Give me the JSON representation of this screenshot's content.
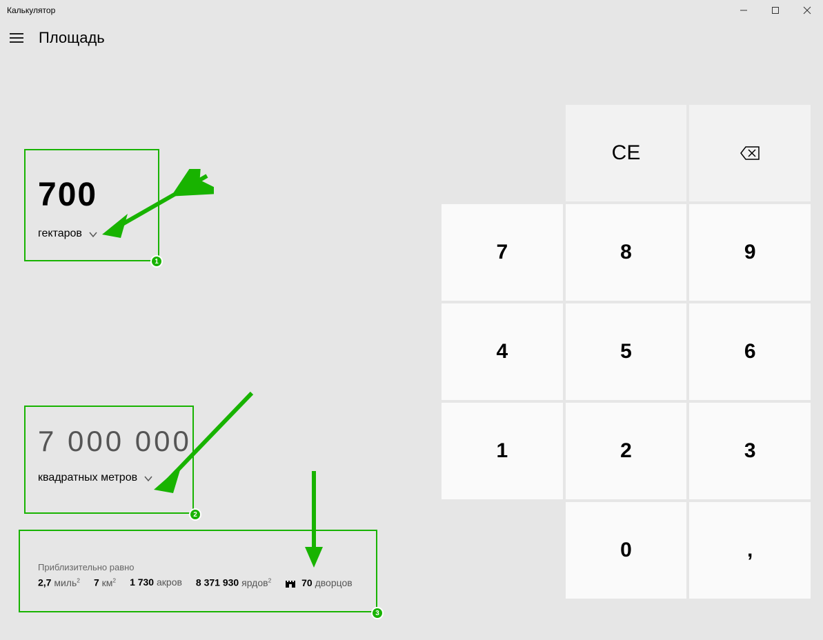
{
  "window": {
    "title": "Калькулятор"
  },
  "header": {
    "mode": "Площадь"
  },
  "input": {
    "value": "700",
    "unit_label": "гектаров"
  },
  "output": {
    "value": "7 000 000",
    "unit_label": "квадратных метров"
  },
  "approx": {
    "label": "Приблизительно равно",
    "miles_v": "2,7",
    "miles_u": "миль",
    "km_v": "7",
    "km_u": "км",
    "acres_v": "1 730",
    "acres_u": "акров",
    "yards_v": "8 371 930",
    "yards_u": "ярдов",
    "castles_v": "70",
    "castles_u": "дворцов"
  },
  "keys": {
    "ce": "CE",
    "k7": "7",
    "k8": "8",
    "k9": "9",
    "k4": "4",
    "k5": "5",
    "k6": "6",
    "k1": "1",
    "k2": "2",
    "k3": "3",
    "k0": "0",
    "kcomma": ","
  },
  "annotations": {
    "badge1": "1",
    "badge2": "2",
    "badge3": "3"
  }
}
